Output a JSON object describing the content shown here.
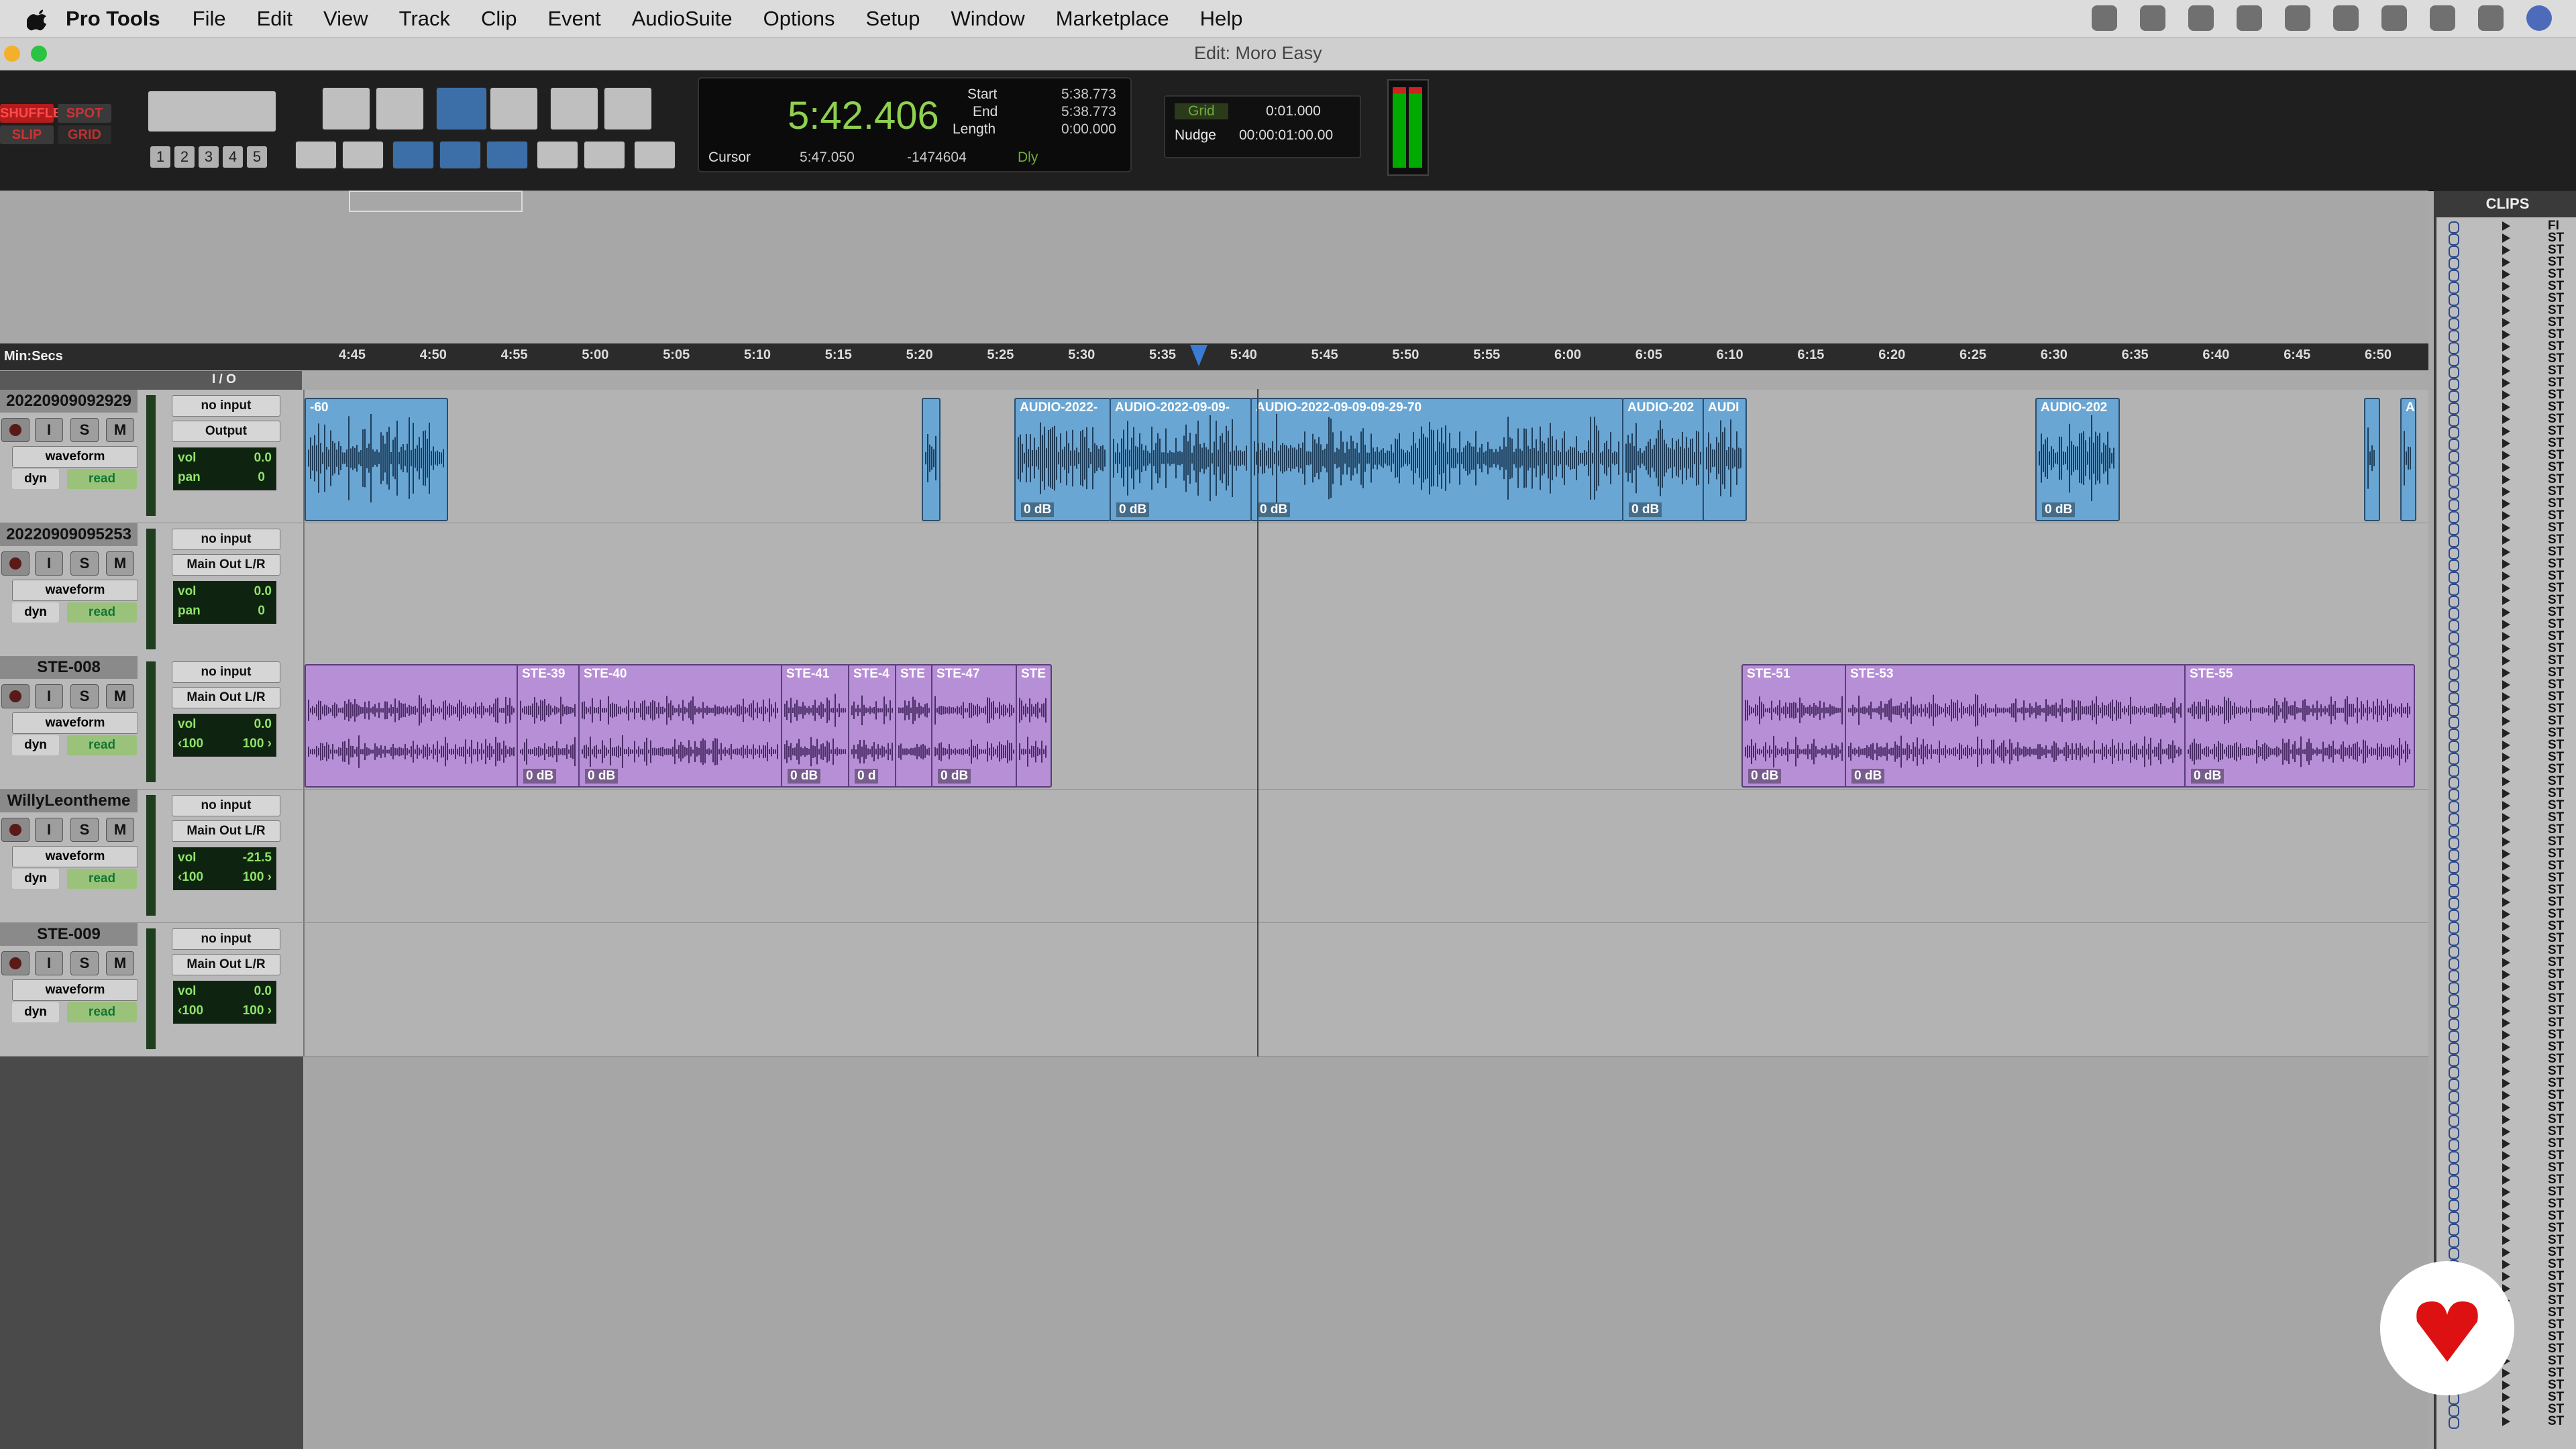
{
  "menubar": {
    "app": "Pro Tools",
    "items": [
      "File",
      "Edit",
      "View",
      "Track",
      "Clip",
      "Event",
      "AudioSuite",
      "Options",
      "Setup",
      "Window",
      "Marketplace",
      "Help"
    ]
  },
  "window": {
    "title": "Edit: Moro Easy"
  },
  "toolbar": {
    "modes": {
      "shuffle": "SHUFFLE",
      "spot": "SPOT",
      "slip": "SLIP",
      "grid": "GRID"
    },
    "zoom_presets": [
      "1",
      "2",
      "3",
      "4",
      "5"
    ]
  },
  "counter": {
    "main": "5:42.406",
    "start_label": "Start",
    "start": "5:38.773",
    "end_label": "End",
    "end": "5:38.773",
    "length_label": "Length",
    "length": "0:00.000",
    "cursor_label": "Cursor",
    "cursor": "5:47.050",
    "cursor_sample": "-1474604",
    "dly": "Dly"
  },
  "grid": {
    "grid_label": "Grid",
    "grid_value": "0:01.000",
    "nudge_label": "Nudge",
    "nudge_value": "00:00:01:00.00"
  },
  "ruler": {
    "label": "Min:Secs",
    "ticks": [
      "4:45",
      "4:50",
      "4:55",
      "5:00",
      "5:05",
      "5:10",
      "5:15",
      "5:20",
      "5:25",
      "5:30",
      "5:35",
      "5:40",
      "5:45",
      "5:50",
      "5:55",
      "6:00",
      "6:05",
      "6:10",
      "6:15",
      "6:20",
      "6:25",
      "6:30",
      "6:35",
      "6:40",
      "6:45",
      "6:50"
    ]
  },
  "io_header": "I / O",
  "tracks": [
    {
      "name": "20220909092929",
      "input": "no input",
      "output": "Output",
      "view": "waveform",
      "dyn": "dyn",
      "auto": "read",
      "vol_label": "vol",
      "vol": "0.0",
      "pan_label": "pan",
      "pan": "0"
    },
    {
      "name": "20220909095253",
      "input": "no input",
      "output": "Main Out L/R",
      "view": "waveform",
      "dyn": "dyn",
      "auto": "read",
      "vol_label": "vol",
      "vol": "0.0",
      "pan_label": "pan",
      "pan": "0"
    },
    {
      "name": "STE-008",
      "input": "no input",
      "output": "Main Out L/R",
      "view": "waveform",
      "dyn": "dyn",
      "auto": "read",
      "vol_label": "vol",
      "vol": "0.0",
      "pan_l": "‹100",
      "pan_r": "100 ›"
    },
    {
      "name": "WillyLeontheme",
      "input": "no input",
      "output": "Main Out L/R",
      "view": "waveform",
      "dyn": "dyn",
      "auto": "read",
      "vol_label": "vol",
      "vol": "-21.5",
      "pan_l": "‹100",
      "pan_r": "100 ›"
    },
    {
      "name": "STE-009",
      "input": "no input",
      "output": "Main Out L/R",
      "view": "waveform",
      "dyn": "dyn",
      "auto": "read",
      "vol_label": "vol",
      "vol": "0.0",
      "pan_l": "‹100",
      "pan_r": "100 ›"
    }
  ],
  "track_buttons": {
    "input": "I",
    "solo": "S",
    "mute": "M"
  },
  "clips_track1": [
    {
      "name": "-60",
      "gain": ""
    },
    {
      "name": "",
      "gain": ""
    },
    {
      "name": "AUDIO-2022-",
      "gain": "0 dB"
    },
    {
      "name": "AUDIO-2022-09-09-",
      "gain": "0 dB"
    },
    {
      "name": "AUDIO-2022-09-09-09-29-70",
      "gain": "0 dB"
    },
    {
      "name": "AUDIO-202",
      "gain": "0 dB"
    },
    {
      "name": "AUDI",
      "gain": ""
    },
    {
      "name": "AUDIO-202",
      "gain": "0 dB"
    },
    {
      "name": "",
      "gain": ""
    },
    {
      "name": "A",
      "gain": ""
    }
  ],
  "clips_track3": [
    {
      "name": "",
      "gain": ""
    },
    {
      "name": "STE-39",
      "gain": "0 dB"
    },
    {
      "name": "STE-40",
      "gain": "0 dB"
    },
    {
      "name": "STE-41",
      "gain": "0 dB"
    },
    {
      "name": "STE-4",
      "gain": "0 d"
    },
    {
      "name": "STE",
      "gain": ""
    },
    {
      "name": "STE-47",
      "gain": "0 dB"
    },
    {
      "name": "STE",
      "gain": ""
    },
    {
      "name": "STE-51",
      "gain": "0 dB"
    },
    {
      "name": "STE-53",
      "gain": "0 dB"
    },
    {
      "name": "STE-55",
      "gain": "0 dB"
    }
  ],
  "clips_panel": {
    "title": "CLIPS",
    "row_text": "ST",
    "first_row": "FI"
  }
}
